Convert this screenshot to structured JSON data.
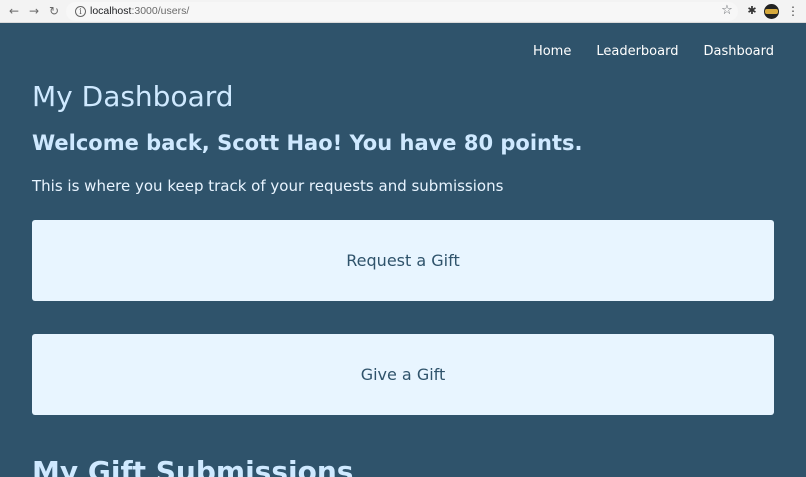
{
  "browser": {
    "url_host": "localhost",
    "url_path": ":3000/users/"
  },
  "nav": {
    "items": [
      "Home",
      "Leaderboard",
      "Dashboard"
    ]
  },
  "main": {
    "title": "My Dashboard",
    "welcome": "Welcome back, Scott Hao! You have 80 points.",
    "subtitle": "This is where you keep track of your requests and submissions",
    "request_gift_label": "Request a Gift",
    "give_gift_label": "Give a Gift",
    "submissions_title": "My Gift Submissions"
  },
  "colors": {
    "background": "#2f536b",
    "card": "#e8f5ff",
    "heading": "#cfe9ff"
  }
}
